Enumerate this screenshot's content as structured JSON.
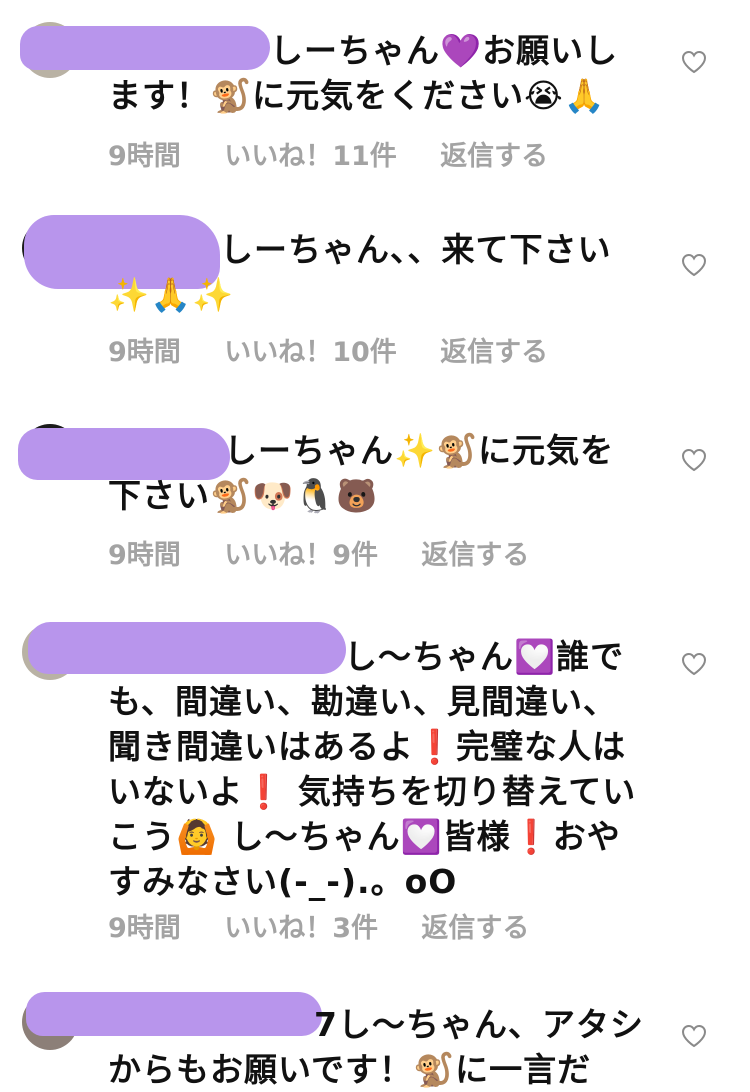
{
  "comments": [
    {
      "text": "しーちゃん💜お願いします！🐒に元気をください😭🙏",
      "time": "9時間",
      "likes": "いいね！11件",
      "reply": "返信する"
    },
    {
      "text": "しーちゃん、、来て下さい✨🙏✨",
      "time": "9時間",
      "likes": "いいね！10件",
      "reply": "返信する"
    },
    {
      "text": "しーちゃん✨🐒に元気を下さい🐒🐶🐧🐻",
      "time": "9時間",
      "likes": "いいね！9件",
      "reply": "返信する"
    },
    {
      "text": "し〜ちゃん💟誰でも、間違い、勘違い、見間違い、聞き間違いはあるよ❗️完璧な人はいないよ❗️ 気持ちを切り替えていこう🙆 し〜ちゃん💟皆様❗️おやすみなさい(-_-).。oO",
      "time": "9時間",
      "likes": "いいね！3件",
      "reply": "返信する"
    },
    {
      "text": "7し〜ちゃん、アタシからもお願いです！🐒に一言だ",
      "time": "",
      "likes": "",
      "reply": ""
    }
  ],
  "icons": {
    "like": "heart-outline-icon"
  },
  "colors": {
    "redaction": "#b895ec",
    "meta_text": "#a3a3a3",
    "body_text": "#111111"
  }
}
